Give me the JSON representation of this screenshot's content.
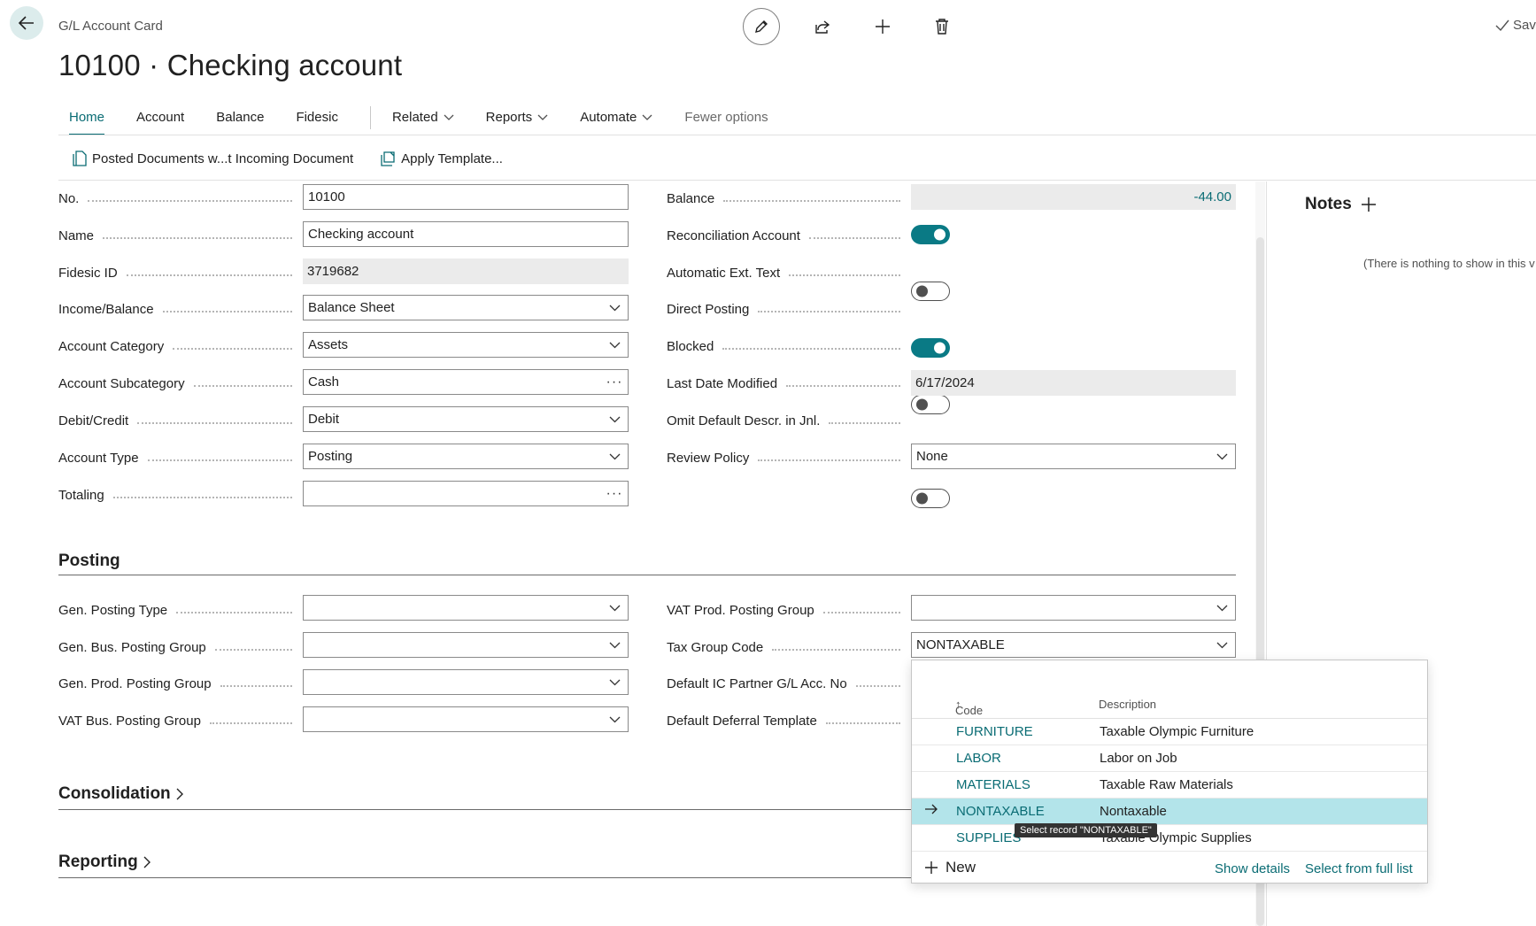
{
  "header": {
    "breadcrumb": "G/L Account Card",
    "title": "10100 · Checking account",
    "saved_label": "Save"
  },
  "tabs": [
    {
      "label": "Home",
      "active": true
    },
    {
      "label": "Account"
    },
    {
      "label": "Balance"
    },
    {
      "label": "Fidesic"
    },
    {
      "label": "Related",
      "dropdown": true
    },
    {
      "label": "Reports",
      "dropdown": true
    },
    {
      "label": "Automate",
      "dropdown": true
    },
    {
      "label": "Fewer options",
      "muted": true
    }
  ],
  "actions": {
    "posted_documents": "Posted Documents w...t Incoming Document",
    "apply_template": "Apply Template..."
  },
  "general": {
    "left": [
      {
        "label": "No.",
        "value": "10100",
        "type": "text"
      },
      {
        "label": "Name",
        "value": "Checking account",
        "type": "text"
      },
      {
        "label": "Fidesic ID",
        "value": "3719682",
        "type": "readonly"
      },
      {
        "label": "Income/Balance",
        "value": "Balance Sheet",
        "type": "select"
      },
      {
        "label": "Account Category",
        "value": "Assets",
        "type": "select"
      },
      {
        "label": "Account Subcategory",
        "value": "Cash",
        "type": "lookup"
      },
      {
        "label": "Debit/Credit",
        "value": "Debit",
        "type": "select"
      },
      {
        "label": "Account Type",
        "value": "Posting",
        "type": "select"
      },
      {
        "label": "Totaling",
        "value": "",
        "type": "lookup"
      }
    ],
    "right": {
      "balance_label": "Balance",
      "balance_value": "-44.00",
      "reconciliation_label": "Reconciliation Account",
      "reconciliation_on": true,
      "auto_ext_label": "Automatic Ext. Text",
      "auto_ext_on": false,
      "direct_posting_label": "Direct Posting",
      "direct_posting_on": true,
      "blocked_label": "Blocked",
      "blocked_on": false,
      "last_modified_label": "Last Date Modified",
      "last_modified_value": "6/17/2024",
      "omit_descr_label": "Omit Default Descr. in Jnl.",
      "omit_descr_on": false,
      "review_policy_label": "Review Policy",
      "review_policy_value": "None"
    }
  },
  "posting": {
    "title": "Posting",
    "gen_posting_type_label": "Gen. Posting Type",
    "gen_bus_label": "Gen. Bus. Posting Group",
    "gen_prod_label": "Gen. Prod. Posting Group",
    "vat_bus_label": "VAT Bus. Posting Group",
    "vat_prod_label": "VAT Prod. Posting Group",
    "tax_group_label": "Tax Group Code",
    "tax_group_value": "NONTAXABLE",
    "default_ic_label": "Default IC Partner G/L Acc. No",
    "default_deferral_label": "Default Deferral Template"
  },
  "sections": {
    "consolidation": "Consolidation",
    "reporting": "Reporting"
  },
  "notes": {
    "title": "Notes",
    "empty": "(There is nothing to show in this v"
  },
  "lookup": {
    "col_code": "Code",
    "col_description": "Description",
    "rows": [
      {
        "code": "FURNITURE",
        "description": "Taxable Olympic Furniture"
      },
      {
        "code": "LABOR",
        "description": "Labor on Job"
      },
      {
        "code": "MATERIALS",
        "description": "Taxable Raw Materials"
      },
      {
        "code": "NONTAXABLE",
        "description": "Nontaxable"
      },
      {
        "code": "SUPPLIES",
        "description": "Taxable Olympic Supplies"
      }
    ],
    "tooltip": "Select record \"NONTAXABLE\"",
    "new_label": "New",
    "show_details": "Show details",
    "select_full_list": "Select from full list"
  },
  "colors": {
    "accent": "#0a6c74",
    "selected_row": "#b3e4ea"
  }
}
